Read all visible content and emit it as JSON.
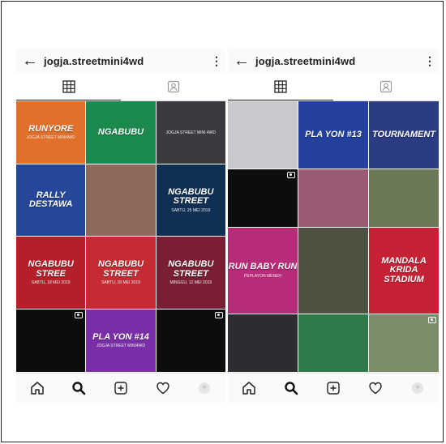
{
  "phones": [
    {
      "username": "jogja.streetmini4wd",
      "posts": [
        {
          "t1": "RUNYORE",
          "t2": "JOGJA STREET MINI4WD",
          "bg": "#e0702a"
        },
        {
          "t1": "NGABUBU",
          "t2": "",
          "bg": "#1c8a4e"
        },
        {
          "t1": "",
          "t2": "JOGJA STREET MINI 4WD",
          "bg": "#3a3b40"
        },
        {
          "t1": "RALLY DESTAWA",
          "t2": "",
          "bg": "#24479a"
        },
        {
          "t1": "",
          "t2": "",
          "bg": "#8e6a5c"
        },
        {
          "t1": "NGABUBU STREET",
          "t2": "SABTU, 25 MEI 2019",
          "bg": "#0f2f55"
        },
        {
          "t1": "NGABUBU STREE",
          "t2": "SABTU, 18 MEI 2019",
          "bg": "#b41f2a"
        },
        {
          "t1": "NGABUBU STREET",
          "t2": "SABTU, 18 MEI 2019",
          "bg": "#c42b33"
        },
        {
          "t1": "NGABUBU STREET",
          "t2": "MINGGU, 12 MEI 2019",
          "bg": "#7a1f33"
        },
        {
          "t1": "",
          "t2": "",
          "bg": "#0d0d0d",
          "video": true
        },
        {
          "t1": "PLA YON #14",
          "t2": "JOGJA STREET MINI4WD",
          "bg": "#7a2ea8"
        },
        {
          "t1": "",
          "t2": "",
          "bg": "#0d0d0d",
          "video": true
        }
      ]
    },
    {
      "username": "jogja.streetmini4wd",
      "posts": [
        {
          "t1": "",
          "t2": "",
          "bg": "#c8cace"
        },
        {
          "t1": "PLA YON #13",
          "t2": "",
          "bg": "#23409c"
        },
        {
          "t1": "TOURNAMENT",
          "t2": "",
          "bg": "#2b3c83"
        },
        {
          "t1": "",
          "t2": "",
          "bg": "#0d0d0d",
          "video": true
        },
        {
          "t1": "",
          "t2": "",
          "bg": "#9a5a73"
        },
        {
          "t1": "",
          "t2": "",
          "bg": "#6a7a58"
        },
        {
          "t1": "RUN BABY RUN",
          "t2": "PEPLAYON MENEH",
          "bg": "#b82b79"
        },
        {
          "t1": "",
          "t2": "",
          "bg": "#4d5340"
        },
        {
          "t1": "MANDALA KRIDA STADIUM",
          "t2": "",
          "bg": "#c52236"
        },
        {
          "t1": "",
          "t2": "",
          "bg": "#2c2d31"
        },
        {
          "t1": "",
          "t2": "",
          "bg": "#2e7a4b"
        },
        {
          "t1": "",
          "t2": "",
          "bg": "#7a8d6a",
          "video": true
        }
      ]
    }
  ]
}
